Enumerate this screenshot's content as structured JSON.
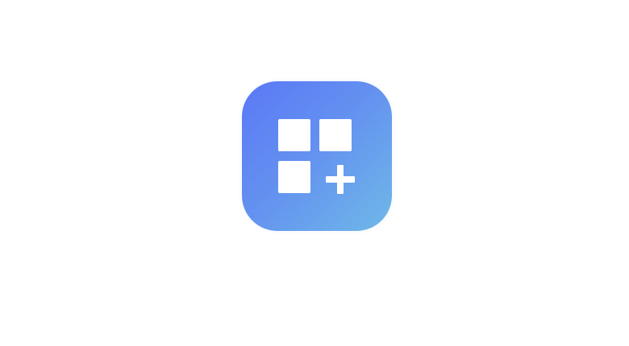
{
  "app_icon": {
    "icon": "apps-add-icon",
    "glyph_icons": [
      "square-tile-icon",
      "square-tile-icon",
      "square-tile-icon",
      "plus-icon"
    ],
    "colors": {
      "gradient_start": "#5b78f6",
      "gradient_mid": "#6390f0",
      "gradient_end": "#6fb8e8",
      "glyph": "#ffffff",
      "background": "#ffffff"
    }
  }
}
